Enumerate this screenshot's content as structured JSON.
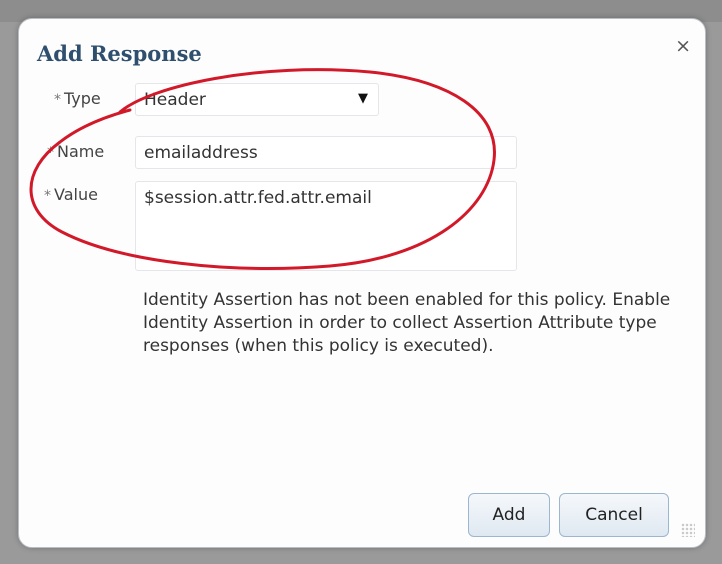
{
  "dialog": {
    "title": "Add Response",
    "close_label": "×"
  },
  "form": {
    "required_marker": "*",
    "type_label": "Type",
    "type_value": "Header",
    "type_arrow": "▼",
    "name_label": "Name",
    "name_value": "emailaddress",
    "value_label": "Value",
    "value_value": "$session.attr.fed.attr.email"
  },
  "message": "Identity Assertion has not been enabled for this policy. Enable Identity Assertion in order to collect Assertion Attribute type responses (when this policy is executed).",
  "buttons": {
    "add": "Add",
    "cancel": "Cancel"
  },
  "colors": {
    "title": "#2f4f6f",
    "annotation": "#d2192a"
  }
}
